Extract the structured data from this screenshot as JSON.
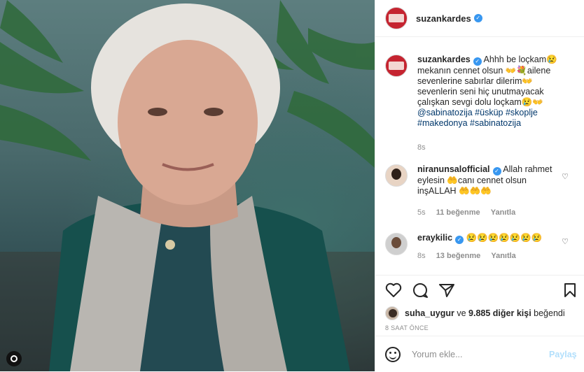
{
  "post": {
    "username": "suzankardes",
    "caption_parts": [
      "Ahhh be loçkam😢 mekanın cennet olsun 👐💐ailene sevenlerine sabırlar dilerim👐 sevenlerin seni hiç unutmayacak çalışkan sevgi dolu loçkam😢👐 ",
      "@sabinatozija #üsküp #skoplje #makedonya #sabinatozija"
    ],
    "caption_age": "8s"
  },
  "comments": [
    {
      "username": "niranunsalofficial",
      "text": "Allah rahmet eylesin 🤲canı cennet olsun inşALLAH 🤲🤲🤲",
      "age": "5s",
      "likes": "11 beğenme",
      "reply": "Yanıtla"
    },
    {
      "username": "eraykilic",
      "text": "😢😢😢😢😢😢😢",
      "age": "8s",
      "likes": "13 beğenme",
      "reply": "Yanıtla"
    }
  ],
  "likes_line": {
    "user": "suha_uygur",
    "connector": "ve",
    "others": "9.885 diğer kişi",
    "suffix": "beğendi"
  },
  "timestamp": "8 SAAT ÖNCE",
  "composer": {
    "placeholder": "Yorum ekle...",
    "post_label": "Paylaş"
  },
  "icons": [
    "heart-icon",
    "comment-icon",
    "share-icon",
    "bookmark-icon",
    "smile-icon",
    "verified-icon",
    "instagram-icon"
  ],
  "colors": {
    "link": "#00376b",
    "verified": "#3897f0",
    "muted": "#8e8e8e",
    "post_button": "#b2dffc"
  }
}
